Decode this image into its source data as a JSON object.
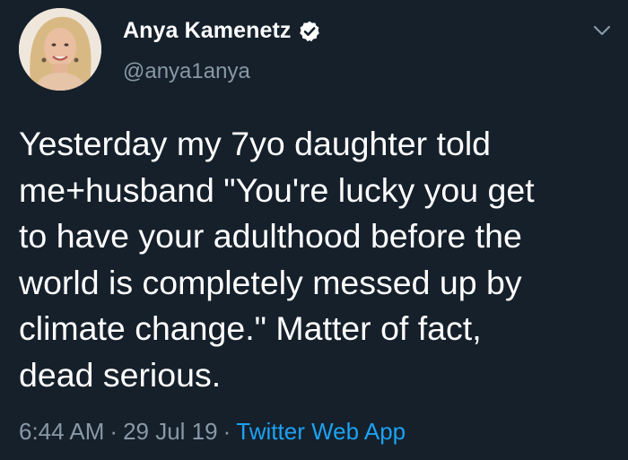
{
  "tweet": {
    "author": {
      "display_name": "Anya Kamenetz",
      "handle": "@anya1anya",
      "verified": true,
      "avatar_icon": "profile-photo"
    },
    "text_lines": [
      "Yesterday my 7yo daughter told",
      "me+husband \"You're lucky you get",
      "to have your adulthood before the",
      "world is completely messed up by",
      "climate change.\" Matter of fact,",
      "dead serious."
    ],
    "time": "6:44 AM",
    "date": "29 Jul 19",
    "source": "Twitter Web App",
    "separator": "·",
    "menu_icon": "chevron-down-icon"
  },
  "colors": {
    "background": "#15202b",
    "text": "#ffffff",
    "secondary_text": "#8899a6",
    "link": "#1da1f2",
    "verified_badge": "#ffffff"
  }
}
